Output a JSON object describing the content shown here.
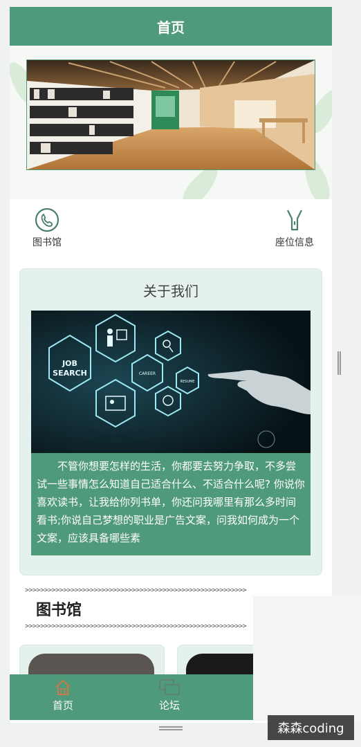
{
  "header": {
    "title": "首页"
  },
  "nav": [
    {
      "label": "图书馆",
      "icon": "phone-icon"
    },
    {
      "label": "座位信息",
      "icon": "flashlight-icon"
    }
  ],
  "about": {
    "title": "关于我们",
    "image_words": {
      "job": "JOB",
      "search": "SEARCH",
      "career": "CAREER",
      "resume": "RESUME"
    },
    "text": "　　不管你想要怎样的生活，你都要去努力争取，不多尝试一些事情怎么知道自己适合什么、不适合什么呢? 你说你喜欢读书，让我给你列书单，你还问我哪里有那么多时间看书;你说自己梦想的职业是广告文案，问我如何成为一个文案，应该具备哪些素"
  },
  "divider": ">>>>>>>>>>>>>>>>>>>>>>>>>>>>>>>>>>>>>>>>>>>>>>>>>>>>>>>>>>",
  "section": {
    "title": "图书馆"
  },
  "tabs": [
    {
      "label": "首页",
      "icon": "home-icon"
    },
    {
      "label": "论坛",
      "icon": "forum-icon"
    }
  ],
  "watermark": "森森coding",
  "colors": {
    "primary": "#4f9a7b",
    "card_bg": "#e5f1ec"
  }
}
